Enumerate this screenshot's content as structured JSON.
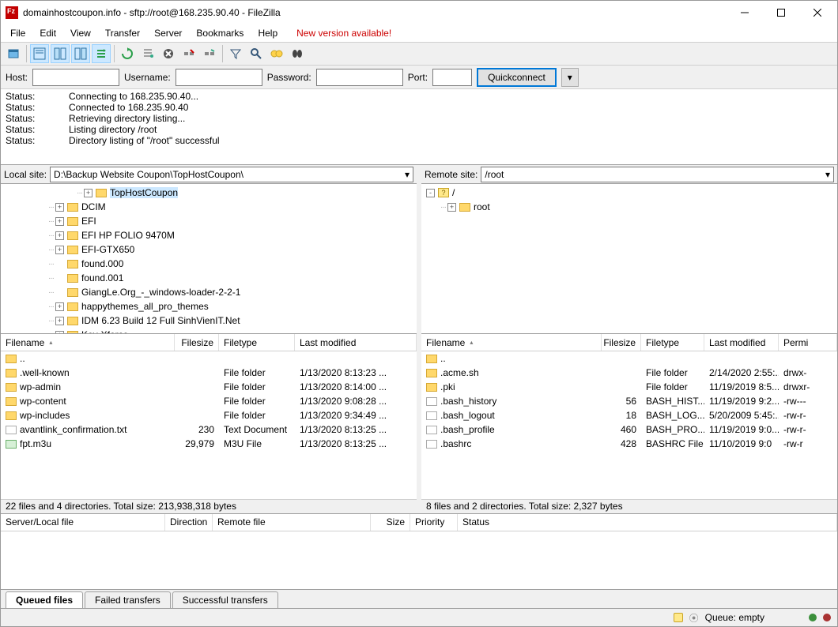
{
  "window": {
    "title": "domainhostcoupon.info - sftp://root@168.235.90.40 - FileZilla"
  },
  "menu": {
    "items": [
      "File",
      "Edit",
      "View",
      "Transfer",
      "Server",
      "Bookmarks",
      "Help"
    ],
    "new_version": "New version available!"
  },
  "quickconnect": {
    "host_label": "Host:",
    "user_label": "Username:",
    "pass_label": "Password:",
    "port_label": "Port:",
    "button": "Quickconnect"
  },
  "log": [
    {
      "label": "Status:",
      "msg": "Connecting to 168.235.90.40..."
    },
    {
      "label": "Status:",
      "msg": "Connected to 168.235.90.40"
    },
    {
      "label": "Status:",
      "msg": "Retrieving directory listing..."
    },
    {
      "label": "Status:",
      "msg": "Listing directory /root"
    },
    {
      "label": "Status:",
      "msg": "Directory listing of \"/root\" successful"
    }
  ],
  "local": {
    "label": "Local site:",
    "path": "D:\\Backup Website Coupon\\TopHostCoupon\\",
    "tree": [
      {
        "indent": 5,
        "exp": "+",
        "name": "TopHostCoupon",
        "sel": true
      },
      {
        "indent": 3,
        "exp": "+",
        "name": "DCIM"
      },
      {
        "indent": 3,
        "exp": "+",
        "name": "EFI"
      },
      {
        "indent": 3,
        "exp": "+",
        "name": "EFI HP FOLIO 9470M"
      },
      {
        "indent": 3,
        "exp": "+",
        "name": "EFI-GTX650"
      },
      {
        "indent": 3,
        "exp": "",
        "name": "found.000"
      },
      {
        "indent": 3,
        "exp": "",
        "name": "found.001"
      },
      {
        "indent": 3,
        "exp": "",
        "name": "GiangLe.Org_-_windows-loader-2-2-1"
      },
      {
        "indent": 3,
        "exp": "+",
        "name": "happythemes_all_pro_themes"
      },
      {
        "indent": 3,
        "exp": "+",
        "name": "IDM 6.23 Build 12 Full SinhVienIT.Net"
      },
      {
        "indent": 3,
        "exp": "+",
        "name": "Key-Xforce"
      }
    ],
    "cols": {
      "name": "Filename",
      "size": "Filesize",
      "type": "Filetype",
      "mod": "Last modified"
    },
    "files": [
      {
        "icon": "folder",
        "name": "..",
        "size": "",
        "type": "",
        "mod": ""
      },
      {
        "icon": "folder",
        "name": ".well-known",
        "size": "",
        "type": "File folder",
        "mod": "1/13/2020 8:13:23 ..."
      },
      {
        "icon": "folder",
        "name": "wp-admin",
        "size": "",
        "type": "File folder",
        "mod": "1/13/2020 8:14:00 ..."
      },
      {
        "icon": "folder",
        "name": "wp-content",
        "size": "",
        "type": "File folder",
        "mod": "1/13/2020 9:08:28 ..."
      },
      {
        "icon": "folder",
        "name": "wp-includes",
        "size": "",
        "type": "File folder",
        "mod": "1/13/2020 9:34:49 ..."
      },
      {
        "icon": "file",
        "name": "avantlink_confirmation.txt",
        "size": "230",
        "type": "Text Document",
        "mod": "1/13/2020 8:13:25 ..."
      },
      {
        "icon": "m3u",
        "name": "fpt.m3u",
        "size": "29,979",
        "type": "M3U File",
        "mod": "1/13/2020 8:13:25 ..."
      }
    ],
    "status": "22 files and 4 directories. Total size: 213,938,318 bytes"
  },
  "remote": {
    "label": "Remote site:",
    "path": "/root",
    "tree": [
      {
        "indent": 0,
        "exp": "-",
        "name": "/",
        "q": true
      },
      {
        "indent": 1,
        "exp": "+",
        "name": "root"
      }
    ],
    "cols": {
      "name": "Filename",
      "size": "Filesize",
      "type": "Filetype",
      "mod": "Last modified",
      "perm": "Permi"
    },
    "files": [
      {
        "icon": "folder",
        "name": "..",
        "size": "",
        "type": "",
        "mod": "",
        "perm": ""
      },
      {
        "icon": "folder",
        "name": ".acme.sh",
        "size": "",
        "type": "File folder",
        "mod": "2/14/2020 2:55:...",
        "perm": "drwx-"
      },
      {
        "icon": "folder",
        "name": ".pki",
        "size": "",
        "type": "File folder",
        "mod": "11/19/2019 8:5...",
        "perm": "drwxr-"
      },
      {
        "icon": "file",
        "name": ".bash_history",
        "size": "56",
        "type": "BASH_HIST...",
        "mod": "11/19/2019 9:2...",
        "perm": "-rw---"
      },
      {
        "icon": "file",
        "name": ".bash_logout",
        "size": "18",
        "type": "BASH_LOG...",
        "mod": "5/20/2009 5:45:...",
        "perm": "-rw-r-"
      },
      {
        "icon": "file",
        "name": ".bash_profile",
        "size": "460",
        "type": "BASH_PRO...",
        "mod": "11/19/2019 9:0...",
        "perm": "-rw-r-"
      },
      {
        "icon": "file",
        "name": ".bashrc",
        "size": "428",
        "type": "BASHRC File",
        "mod": "11/10/2019 9:0",
        "perm": "-rw-r"
      }
    ],
    "status": "8 files and 2 directories. Total size: 2,327 bytes"
  },
  "queue": {
    "cols": [
      "Server/Local file",
      "Direction",
      "Remote file",
      "Size",
      "Priority",
      "Status"
    ]
  },
  "tabs": {
    "items": [
      "Queued files",
      "Failed transfers",
      "Successful transfers"
    ],
    "active": 0
  },
  "statusbar": {
    "queue": "Queue: empty"
  }
}
